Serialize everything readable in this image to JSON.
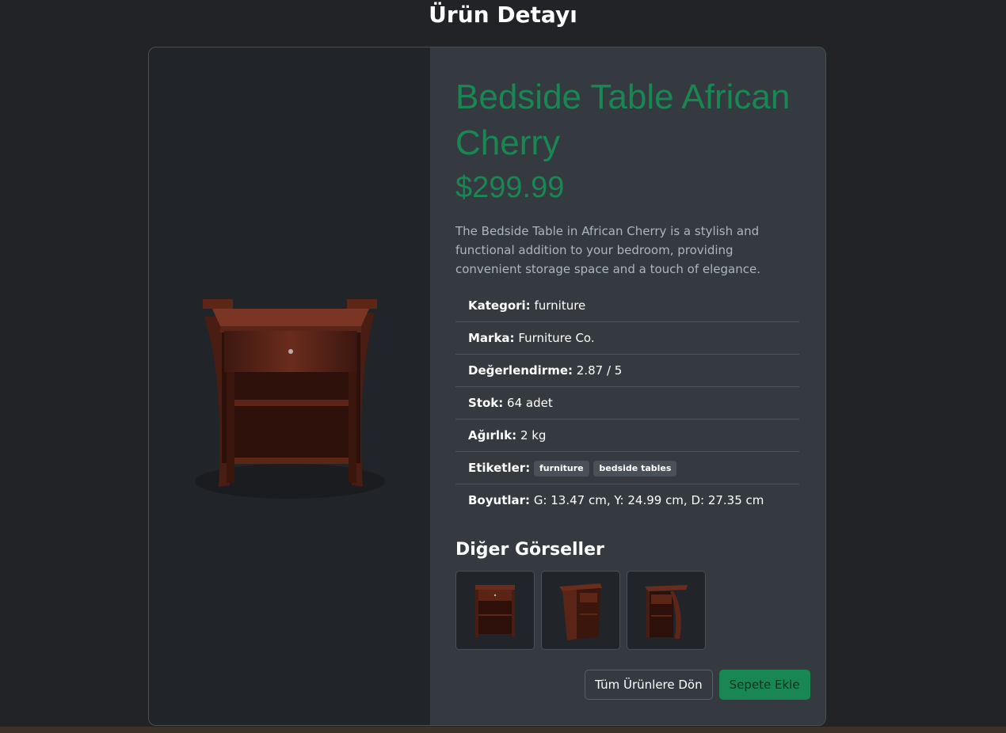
{
  "page": {
    "title": "Ürün Detayı"
  },
  "product": {
    "title": "Bedside Table African Cherry",
    "price": "$299.99",
    "description": "The Bedside Table in African Cherry is a stylish and functional addition to your bedroom, providing convenient storage space and a touch of elegance.",
    "image_icon": "bedside-table-image"
  },
  "specs": {
    "category_label": "Kategori:",
    "category_value": "furniture",
    "brand_label": "Marka:",
    "brand_value": "Furniture Co.",
    "rating_label": "Değerlendirme:",
    "rating_value": "2.87 / 5",
    "stock_label": "Stok:",
    "stock_value": "64 adet",
    "weight_label": "Ağırlık:",
    "weight_value": "2 kg",
    "tags_label": "Etiketler:",
    "tags": [
      "furniture",
      "bedside tables"
    ],
    "dimensions_label": "Boyutlar:",
    "dimensions_value": "G: 13.47 cm, Y: 24.99 cm, D: 27.35 cm"
  },
  "gallery": {
    "title": "Diğer Görseller"
  },
  "actions": {
    "back_label": "Tüm Ürünlere Dön",
    "add_to_cart_label": "Sepete Ekle"
  },
  "colors": {
    "accent": "#198754",
    "background": "#212327",
    "panel": "#343a40"
  }
}
